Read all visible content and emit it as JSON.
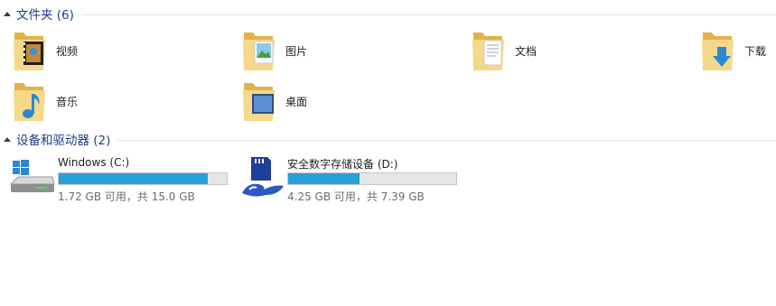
{
  "groups": {
    "folders": {
      "title": "文件夹 (6)"
    },
    "devices": {
      "title": "设备和驱动器 (2)"
    }
  },
  "folders": [
    {
      "label": "视频",
      "icon": "videos-folder-icon"
    },
    {
      "label": "图片",
      "icon": "pictures-folder-icon"
    },
    {
      "label": "文档",
      "icon": "documents-folder-icon"
    },
    {
      "label": "下载",
      "icon": "downloads-folder-icon"
    },
    {
      "label": "音乐",
      "icon": "music-folder-icon"
    },
    {
      "label": "桌面",
      "icon": "desktop-folder-icon"
    }
  ],
  "drives": [
    {
      "name": "Windows (C:)",
      "space": "1.72 GB 可用，共 15.0 GB",
      "used_fraction": 0.885,
      "icon": "windows-drive-icon"
    },
    {
      "name": "安全数字存储设备 (D:)",
      "space": "4.25 GB 可用，共 7.39 GB",
      "used_fraction": 0.425,
      "icon": "sd-card-icon"
    }
  ],
  "colors": {
    "accent": "#26a0da",
    "group_title": "#1e3d87",
    "folder": "#f2d27a"
  }
}
